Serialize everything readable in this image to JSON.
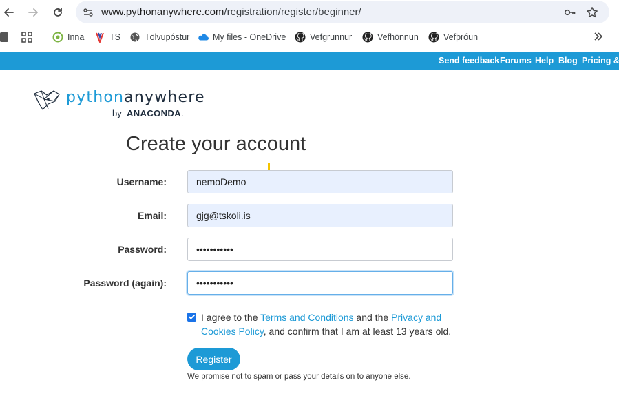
{
  "browser": {
    "url_host": "www.pythonanywhere.com",
    "url_path": "/registration/register/beginner/",
    "bookmarks": [
      {
        "label": "Inna",
        "icon": "target-icon"
      },
      {
        "label": "TS",
        "icon": "ts-icon"
      },
      {
        "label": "Tölvupóstur",
        "icon": "globe-icon"
      },
      {
        "label": "My files - OneDrive",
        "icon": "onedrive-icon"
      },
      {
        "label": "Vefgrunnur",
        "icon": "github-icon"
      },
      {
        "label": "Vefhönnun",
        "icon": "github-icon"
      },
      {
        "label": "Vefþróun",
        "icon": "github-icon"
      }
    ]
  },
  "site_nav": {
    "send_feedback": "Send feedback",
    "forums": "Forums",
    "help": "Help",
    "blog": "Blog",
    "pricing": "Pricing & s"
  },
  "logo": {
    "python": "python",
    "anywhere": "anywhere",
    "by": "by",
    "brand": "ANACONDA",
    "dot": "."
  },
  "form": {
    "title": "Create your account",
    "username_label": "Username:",
    "username_value": "nemoDemo",
    "email_label": "Email:",
    "email_value": "gjg@tskoli.is",
    "password_label": "Password:",
    "password_value": "•••••••••••",
    "password_again_label": "Password (again):",
    "password_again_value": "•••••••••••",
    "agree_prefix": "I agree to the ",
    "terms_link": "Terms and Conditions",
    "agree_mid": " and the ",
    "privacy_link": "Privacy and Cookies Policy",
    "agree_suffix": ", and confirm that I am at least 13 years old.",
    "register_label": "Register",
    "promise_text": "We promise not to spam or pass your details on to anyone else."
  },
  "colors": {
    "accent": "#1d9ad6",
    "checkbox": "#1a73e8"
  }
}
